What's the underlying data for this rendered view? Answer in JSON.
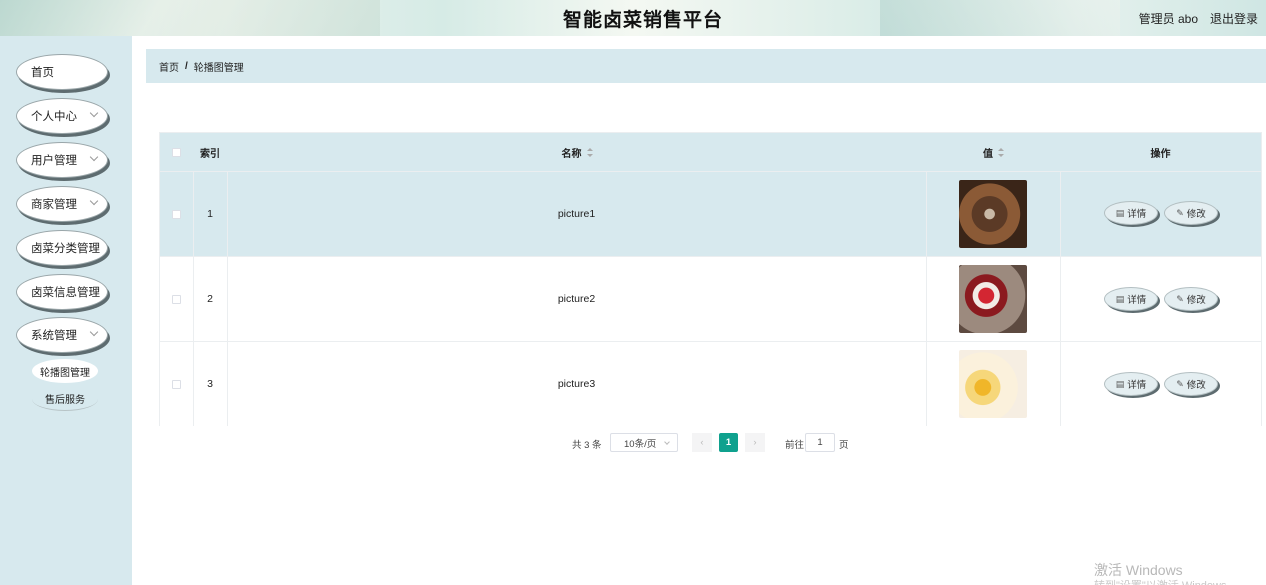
{
  "header": {
    "title": "智能卤菜销售平台",
    "user": "管理员 abo",
    "logout": "退出登录"
  },
  "sidebar": {
    "items": [
      {
        "label": "首页"
      },
      {
        "label": "个人中心"
      },
      {
        "label": "用户管理"
      },
      {
        "label": "商家管理"
      },
      {
        "label": "卤菜分类管理"
      },
      {
        "label": "卤菜信息管理"
      },
      {
        "label": "系统管理"
      }
    ],
    "subitems": [
      {
        "label": "轮播图管理"
      },
      {
        "label": "售后服务"
      }
    ]
  },
  "breadcrumb": {
    "home": "首页",
    "separator": "/",
    "current": "轮播图管理"
  },
  "table": {
    "headers": {
      "index": "索引",
      "name": "名称",
      "value": "值",
      "actions": "操作"
    },
    "rows": [
      {
        "index": "1",
        "name": "picture1",
        "image": "picture1-thumbnail"
      },
      {
        "index": "2",
        "name": "picture2",
        "image": "picture2-thumbnail"
      },
      {
        "index": "3",
        "name": "picture3",
        "image": "picture3-thumbnail"
      }
    ],
    "detail_label": "详情",
    "edit_label": "修改"
  },
  "pagination": {
    "total": "共 3 条",
    "page_size": "10条/页",
    "current_page": "1",
    "goto_label": "前往",
    "goto_value": "1",
    "page_unit": "页"
  },
  "watermark": {
    "line1": "激活 Windows",
    "line2": "转到\"设置\"以激活 Windows。"
  },
  "colors": {
    "accent": "#0fa18e",
    "panel": "#d7e9ee"
  }
}
